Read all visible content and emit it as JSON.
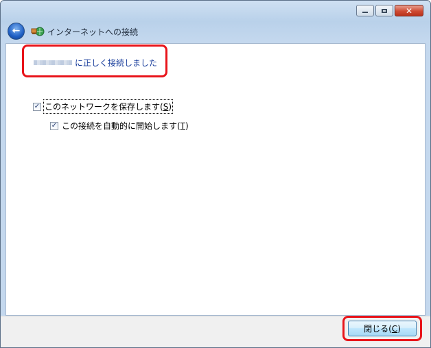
{
  "window": {
    "nav_title": "インターネットへの接続",
    "controls": {
      "minimize_icon": "minimize-icon",
      "maximize_icon": "maximize-icon",
      "close_icon": "close-icon",
      "close_glyph": "✕"
    }
  },
  "nav": {
    "back_icon": "back-arrow-icon",
    "back_glyph": "←",
    "network_icon": "network-connection-icon"
  },
  "main": {
    "status_message": "に正しく接続しました",
    "save_network": {
      "label_prefix": "このネットワークを保存します(",
      "accel": "S",
      "label_suffix": ")",
      "checked": true
    },
    "auto_start": {
      "label_prefix": "この接続を自動的に開始します(",
      "accel": "T",
      "label_suffix": ")",
      "checked": true
    },
    "check_glyph": "✓"
  },
  "footer": {
    "close_button": {
      "label_prefix": "閉じる(",
      "accel": "C",
      "label_suffix": ")"
    }
  },
  "colors": {
    "highlight": "#e8141a",
    "link_text": "#1a3e9c"
  }
}
